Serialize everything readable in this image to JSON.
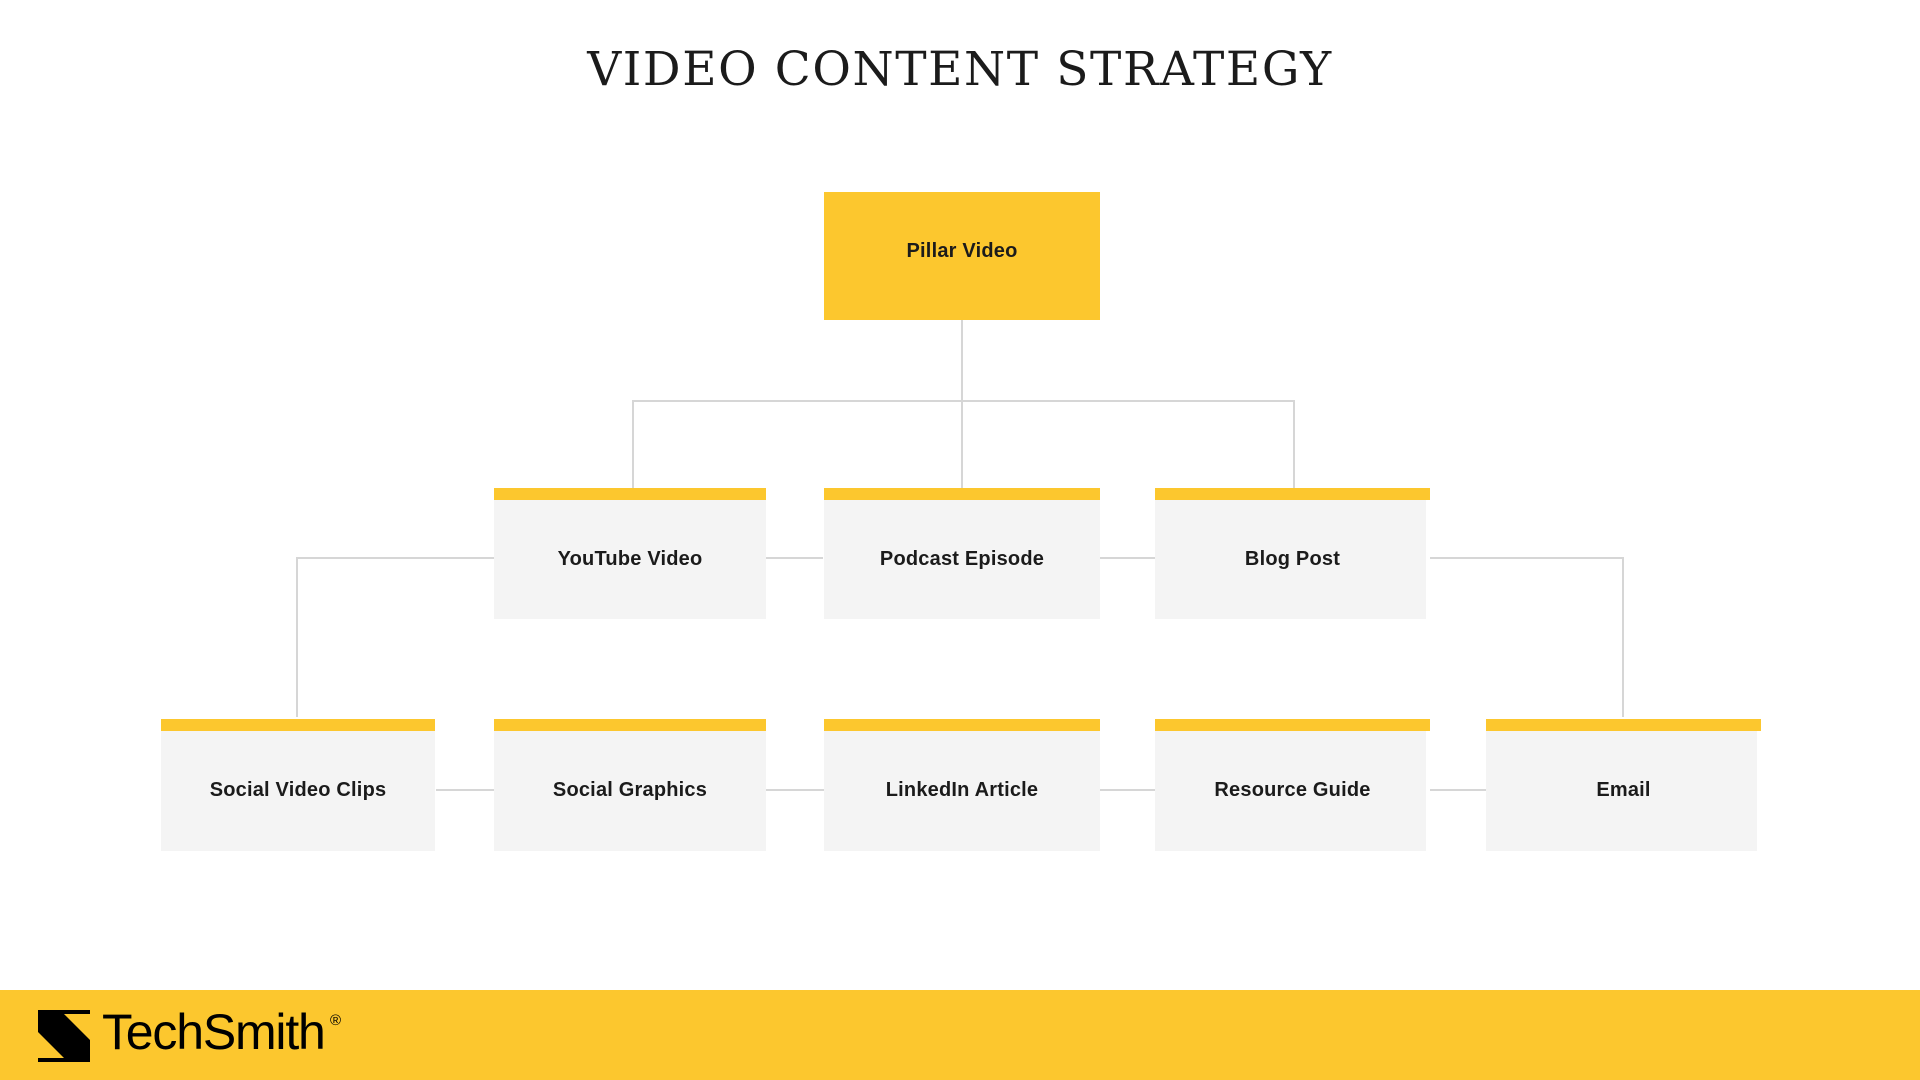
{
  "page": {
    "title": "VIDEO CONTENT STRATEGY",
    "background_color": "#ffffff"
  },
  "theme": {
    "accent_yellow": "#fcc72e",
    "card_body_gray": "#f4f4f4",
    "connector_gray": "#d6d6d6",
    "text_dark": "#1b1b1b"
  },
  "diagram": {
    "type": "hierarchy-tree",
    "tiers": [
      {
        "tier": 1,
        "style": "solid-yellow",
        "nodes": [
          {
            "id": "pillar-video",
            "label": "Pillar Video"
          }
        ]
      },
      {
        "tier": 2,
        "style": "yellow-cap-gray-card",
        "nodes": [
          {
            "id": "youtube-video",
            "label": "YouTube Video"
          },
          {
            "id": "podcast-episode",
            "label": "Podcast Episode"
          },
          {
            "id": "blog-post",
            "label": "Blog Post"
          }
        ]
      },
      {
        "tier": 3,
        "style": "yellow-cap-gray-card",
        "nodes": [
          {
            "id": "social-video-clips",
            "label": "Social Video Clips"
          },
          {
            "id": "social-graphics",
            "label": "Social Graphics"
          },
          {
            "id": "linkedin-article",
            "label": "LinkedIn Article"
          },
          {
            "id": "resource-guide",
            "label": "Resource Guide"
          },
          {
            "id": "email",
            "label": "Email"
          }
        ]
      }
    ]
  },
  "footer": {
    "brand": "TechSmith",
    "trademark": "®",
    "logo_icon": "techsmith-logo-icon",
    "background_color": "#fcc72e"
  }
}
